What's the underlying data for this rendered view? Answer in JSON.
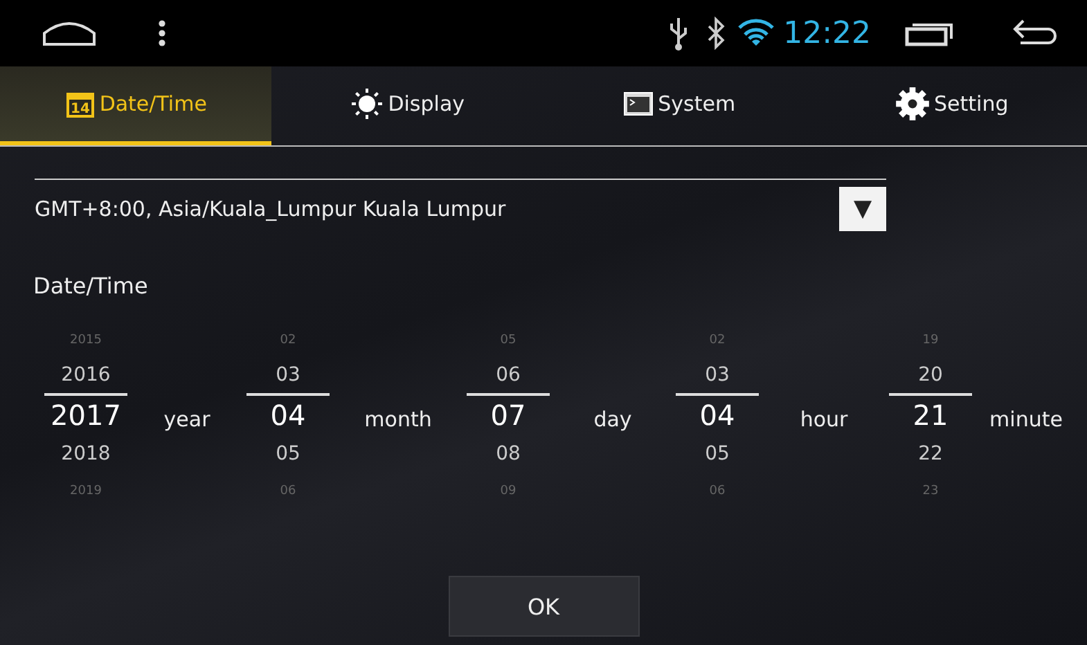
{
  "status_bar": {
    "time": "12:22"
  },
  "tabs": [
    {
      "label": "Date/Time",
      "kind": "calendar",
      "calendar_day": "14",
      "selected": true
    },
    {
      "label": "Display",
      "kind": "sun",
      "selected": false
    },
    {
      "label": "System",
      "kind": "terminal",
      "selected": false
    },
    {
      "label": "Setting",
      "kind": "gear",
      "selected": false
    }
  ],
  "timezone": {
    "value": "GMT+8:00, Asia/Kuala_Lumpur  Kuala Lumpur",
    "arrow": "▼"
  },
  "section_label": "Date/Time",
  "pickers": [
    {
      "unit": "year",
      "values": [
        "2015",
        "2016",
        "2017",
        "2018",
        "2019"
      ]
    },
    {
      "unit": "month",
      "values": [
        "02",
        "03",
        "04",
        "05",
        "06"
      ]
    },
    {
      "unit": "day",
      "values": [
        "05",
        "06",
        "07",
        "08",
        "09"
      ]
    },
    {
      "unit": "hour",
      "values": [
        "02",
        "03",
        "04",
        "05",
        "06"
      ]
    },
    {
      "unit": "minute",
      "values": [
        "19",
        "20",
        "21",
        "22",
        "23"
      ]
    }
  ],
  "ok_button": "OK"
}
